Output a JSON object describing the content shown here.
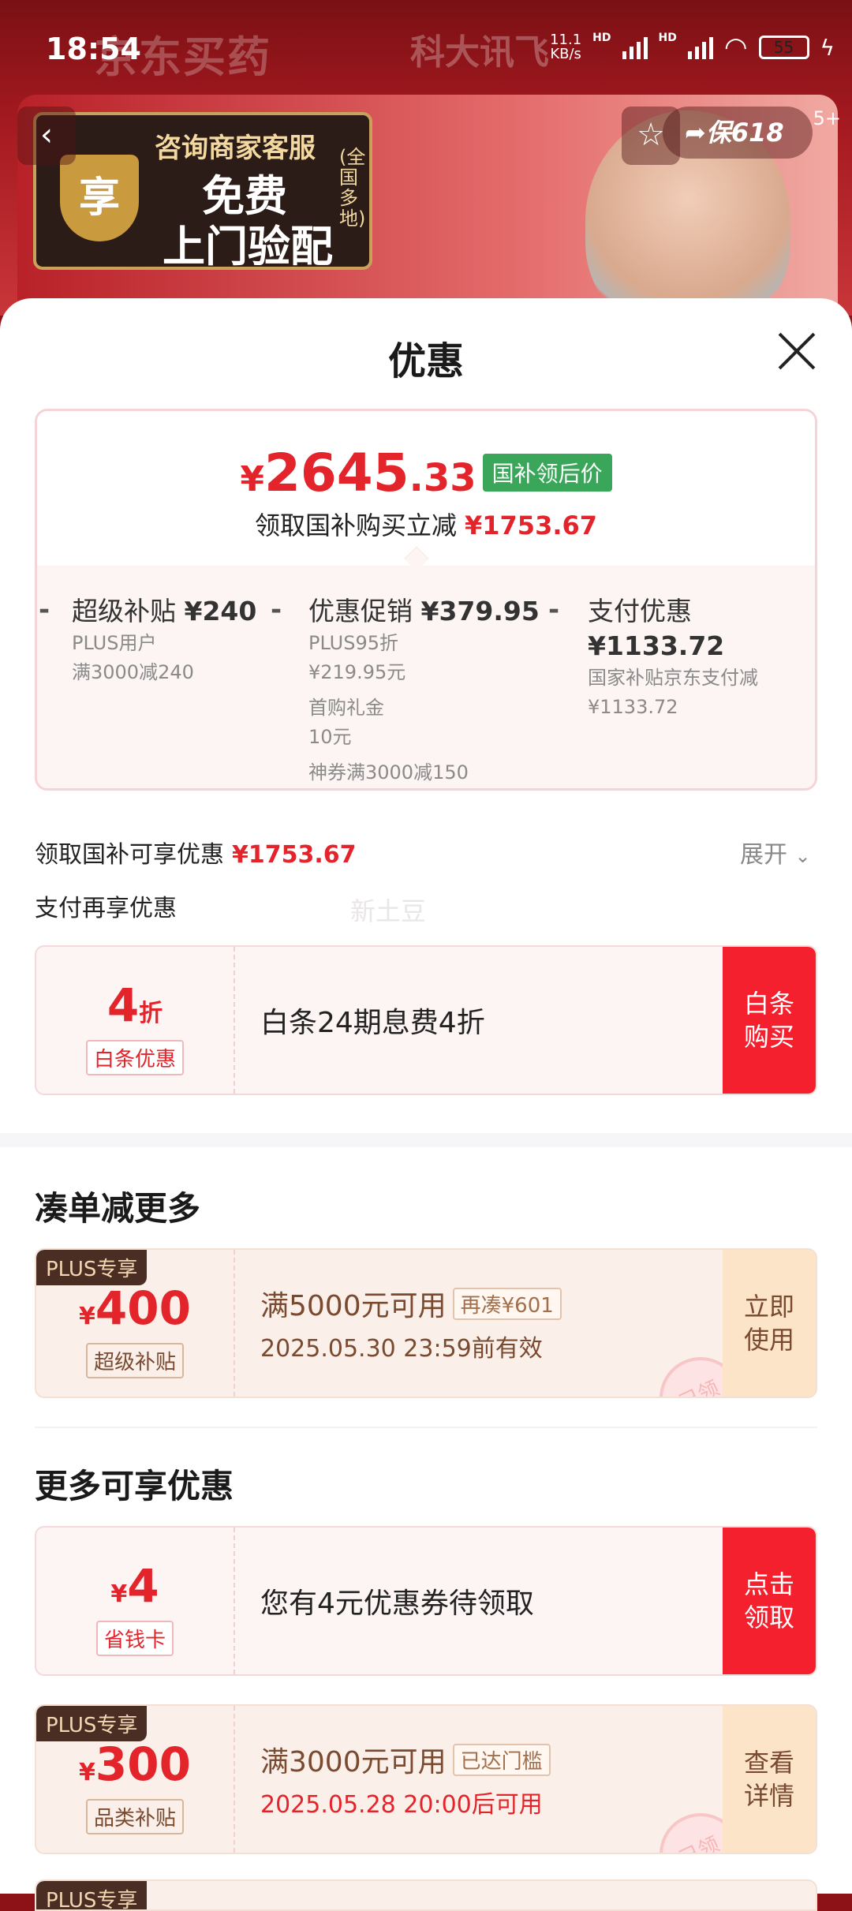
{
  "status": {
    "time": "18:54",
    "net_speed": "11.1\nKB/s",
    "hd1": "HD",
    "hd2": "HD",
    "battery": "55"
  },
  "background": {
    "title": "京东买药",
    "logo": "科大讯飞",
    "share": "保618",
    "badge": "5+"
  },
  "banner": {
    "icon": "享",
    "line1": "咨询商家客服",
    "line2": "免费",
    "line3": "上门验配",
    "side": "(全国多地)"
  },
  "sheet": {
    "title": "优惠",
    "price": {
      "yen": "¥",
      "integer": "2645",
      "decimal": ".33",
      "tag": "国补领后价",
      "sub_label": "领取国补购买立减",
      "sub_value": "¥1753.67"
    },
    "breakdown": [
      {
        "title": "超级补贴",
        "value": "¥240",
        "lines": [
          "PLUS用户",
          "满3000减240"
        ]
      },
      {
        "title": "优惠促销",
        "value": "¥379.95",
        "lines": [
          "PLUS95折",
          "¥219.95元",
          "首购礼金",
          "10元",
          "神券满3000减150"
        ]
      },
      {
        "title": "支付优惠",
        "value": "¥1133.72",
        "lines": [
          "国家补贴京东支付减",
          "¥1133.72"
        ]
      }
    ],
    "subsidy_label": "领取国补可享优惠",
    "subsidy_value": "¥1753.67",
    "expand": "展开",
    "pay_label": "支付再享优惠",
    "watermark": "新土豆",
    "baitiao": {
      "amount": "4",
      "unit": "折",
      "badge": "白条优惠",
      "text": "白条24期息费4折",
      "action": "白条购买"
    },
    "section1": "凑单减更多",
    "coupon1": {
      "plus": "PLUS专享",
      "yen": "¥",
      "amount": "400",
      "badge": "超级补贴",
      "title": "满5000元可用",
      "chip": "再凑¥601",
      "date": "2025.05.30 23:59前有效",
      "action": "立即使用",
      "stamp": "已领"
    },
    "section2": "更多可享优惠",
    "coupon2": {
      "yen": "¥",
      "amount": "4",
      "badge": "省钱卡",
      "text": "您有4元优惠券待领取",
      "action": "点击领取"
    },
    "coupon3": {
      "plus": "PLUS专享",
      "yen": "¥",
      "amount": "300",
      "badge": "品类补贴",
      "title": "满3000元可用",
      "chip": "已达门槛",
      "date": "2025.05.28 20:00后可用",
      "action": "查看详情",
      "stamp": "已领"
    },
    "coupon4": {
      "plus": "PLUS专享"
    }
  }
}
